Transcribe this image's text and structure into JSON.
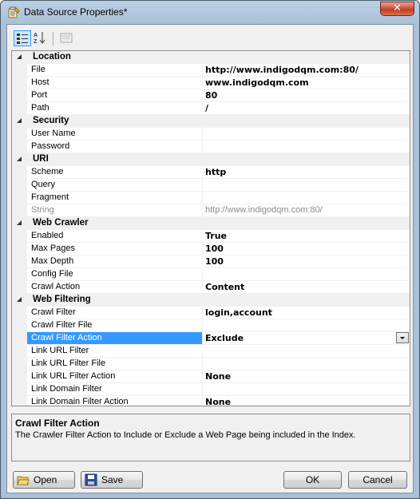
{
  "window": {
    "title": "Data Source Properties*"
  },
  "categories": [
    {
      "name": "Location",
      "rows": [
        {
          "name": "File",
          "value": "http://www.indigodqm.com:80/"
        },
        {
          "name": "Host",
          "value": "www.indigodqm.com"
        },
        {
          "name": "Port",
          "value": "80"
        },
        {
          "name": "Path",
          "value": "/"
        }
      ]
    },
    {
      "name": "Security",
      "rows": [
        {
          "name": "User Name",
          "value": ""
        },
        {
          "name": "Password",
          "value": ""
        }
      ]
    },
    {
      "name": "URI",
      "rows": [
        {
          "name": "Scheme",
          "value": "http"
        },
        {
          "name": "Query",
          "value": ""
        },
        {
          "name": "Fragment",
          "value": ""
        },
        {
          "name": "String",
          "value": "http://www.indigodqm.com:80/",
          "readonly": true
        }
      ]
    },
    {
      "name": "Web Crawler",
      "rows": [
        {
          "name": "Enabled",
          "value": "True"
        },
        {
          "name": "Max Pages",
          "value": "100"
        },
        {
          "name": "Max Depth",
          "value": "100"
        },
        {
          "name": "Config File",
          "value": ""
        },
        {
          "name": "Crawl Action",
          "value": "Content"
        }
      ]
    },
    {
      "name": "Web Filtering",
      "rows": [
        {
          "name": "Crawl Filter",
          "value": "login,account"
        },
        {
          "name": "Crawl Filter File",
          "value": ""
        },
        {
          "name": "Crawl Filter Action",
          "value": "Exclude",
          "selected": true
        },
        {
          "name": "Link URL Filter",
          "value": ""
        },
        {
          "name": "Link URL Filter File",
          "value": ""
        },
        {
          "name": "Link URL Filter Action",
          "value": "None"
        },
        {
          "name": "Link Domain Filter",
          "value": ""
        },
        {
          "name": "Link Domain Filter Action",
          "value": "None"
        }
      ]
    }
  ],
  "description": {
    "title": "Crawl Filter Action",
    "text": "The Crawler Filter Action to Include or Exclude a Web Page being included in the Index."
  },
  "buttons": {
    "open": "Open",
    "save": "Save",
    "ok": "OK",
    "cancel": "Cancel"
  },
  "colors": {
    "selection": "#3399ff",
    "close": "#c13a22"
  }
}
